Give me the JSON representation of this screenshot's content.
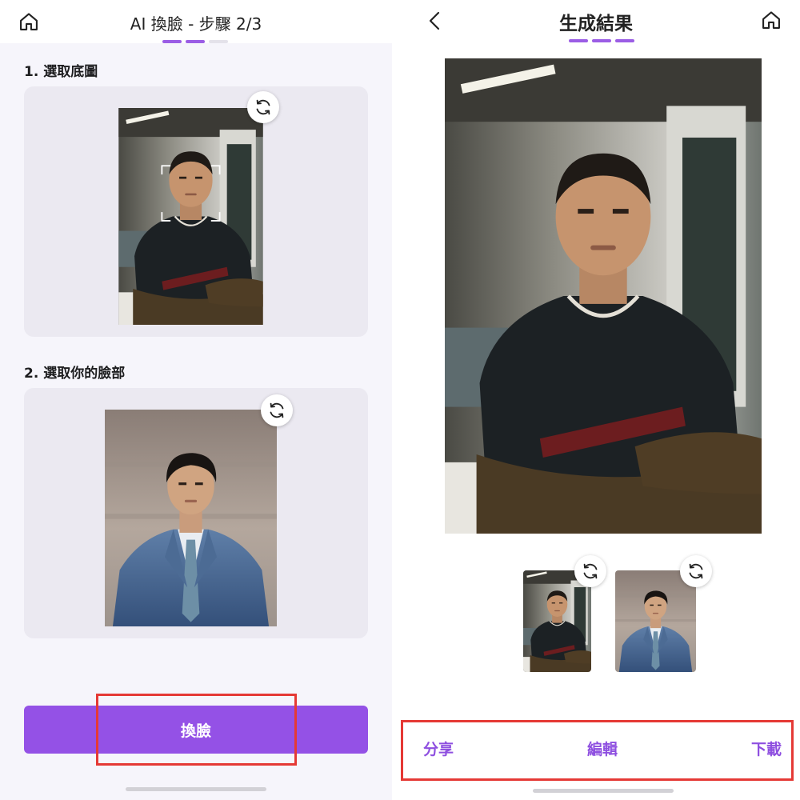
{
  "left": {
    "title": "AI 換臉 - 步驟 2/3",
    "progress_steps": 3,
    "progress_done": 2,
    "section1_label": "1. 選取底圖",
    "section2_label": "2. 選取你的臉部",
    "cta_label": "換臉",
    "icons": [
      "home-icon",
      "refresh-icon",
      "face-frame-icon"
    ]
  },
  "right": {
    "title": "生成結果",
    "progress_steps": 3,
    "progress_done": 3,
    "actions": {
      "share": "分享",
      "edit": "編輯",
      "download": "下載"
    },
    "icons": [
      "back-chevron-icon",
      "home-icon",
      "refresh-icon"
    ]
  },
  "colors": {
    "accent": "#9451e6",
    "progress": "#9b5de5",
    "highlight_box": "#e53935",
    "card_bg": "#ebe9f1"
  }
}
